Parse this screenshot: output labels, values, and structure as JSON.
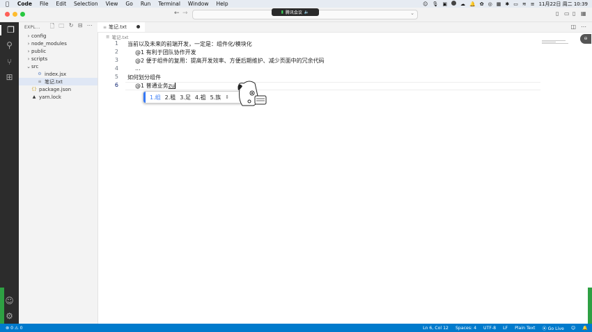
{
  "menubar": {
    "app": "Code",
    "items": [
      "File",
      "Edit",
      "Selection",
      "View",
      "Go",
      "Run",
      "Terminal",
      "Window",
      "Help"
    ],
    "datetime": "11月22日 周二  10:39"
  },
  "meeting": {
    "label": "腾讯会议"
  },
  "explorer": {
    "header": "EXPL...",
    "items": [
      {
        "label": "config",
        "kind": "folder",
        "chev": "›",
        "icon": ""
      },
      {
        "label": "node_modules",
        "kind": "folder",
        "chev": "›",
        "icon": ""
      },
      {
        "label": "public",
        "kind": "folder",
        "chev": "›",
        "icon": ""
      },
      {
        "label": "scripts",
        "kind": "folder",
        "chev": "›",
        "icon": ""
      },
      {
        "label": "src",
        "kind": "folder-open",
        "chev": "⌄",
        "icon": ""
      },
      {
        "label": "index.jsx",
        "kind": "file",
        "chev": "",
        "icon": "⚙"
      },
      {
        "label": "笔记.txt",
        "kind": "file",
        "chev": "",
        "icon": "≡"
      },
      {
        "label": "package.json",
        "kind": "file",
        "chev": "",
        "icon": "{}"
      },
      {
        "label": "yarn.lock",
        "kind": "file",
        "chev": "",
        "icon": "▲"
      }
    ]
  },
  "tab": {
    "label": "笔记.txt"
  },
  "breadcrumb": {
    "label": "笔记.txt"
  },
  "code": {
    "lines": [
      {
        "num": "1",
        "text": "当前以及未来的前端开发，一定是：组件化/模块化"
      },
      {
        "num": "2",
        "text": "@1 有利于团队协作开发"
      },
      {
        "num": "3",
        "text": "@2 便于组件的复用：提高开发效率、方便后期维护、减少页面中的冗余代码"
      },
      {
        "num": "4",
        "text": "..."
      },
      {
        "num": "5",
        "text": "如何划分组件"
      },
      {
        "num": "6",
        "text": "@1 普通业务",
        "composing": "zu"
      }
    ]
  },
  "ime": {
    "candidates": [
      "1.组",
      "2.租",
      "3.足",
      "4.祖",
      "5.族"
    ],
    "more": "⇕"
  },
  "statusbar": {
    "problems": "⊗ 0 ⚠ 0",
    "position": "Ln 6, Col 12",
    "spaces": "Spaces: 4",
    "encoding": "UTF-8",
    "eol": "LF",
    "language": "Plain Text",
    "golive": "⦿ Go Live"
  }
}
